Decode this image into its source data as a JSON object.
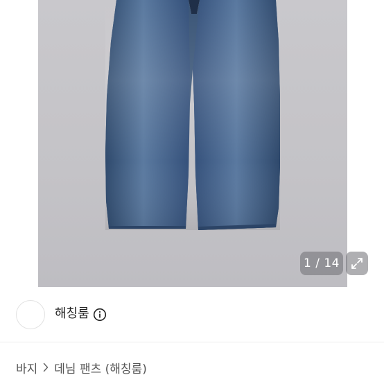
{
  "gallery": {
    "page_counter": "1 / 14",
    "icons": {
      "expand": "expand-icon"
    },
    "colors": {
      "background": "#c6c5c9",
      "denim": "#3f5a7c"
    }
  },
  "seller": {
    "name": "해칭룸",
    "icons": {
      "info": "info-circle-icon"
    }
  },
  "breadcrumb": {
    "category": "바지",
    "subcategory": "데님 팬츠 (해칭룸)",
    "icons": {
      "separator": "chevron-right-icon"
    }
  }
}
